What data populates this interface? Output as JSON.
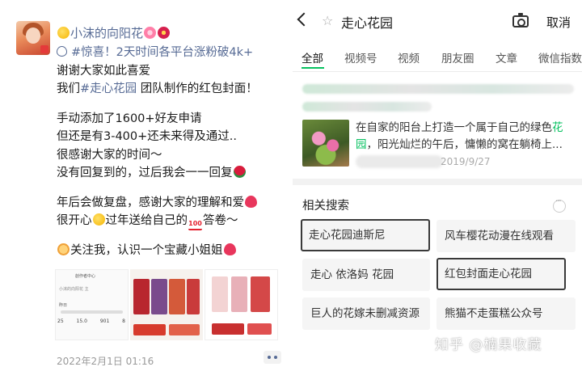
{
  "moment": {
    "username": "小沫的向阳花",
    "lines": [
      "#惊喜！2天时间各平台涨粉破4k+",
      "谢谢大家如此喜爱",
      "我们",
      "#走心花园",
      " 团队制作的红包封面！",
      "手动添加了1600+好友申请",
      "但还是有3-400+还未来得及通过..",
      "很感谢大家的时间～",
      "没有回复到的，过后我会一一回复",
      "年后会做复盘，感谢大家的理解和爱",
      "很开心",
      "过年送给自己的",
      "答卷～",
      "关注我，认识一个宝藏小姐姐"
    ],
    "thumb1": {
      "title": "創作者中心",
      "sub": "小沫的向阳花 主",
      "label": "昨日",
      "stats": [
        "25",
        "15.0",
        "901",
        "8"
      ]
    },
    "datetime": "2022年2月1日 01:16"
  },
  "search": {
    "query": "走心花园",
    "cancel_label": "取消",
    "tabs": [
      "全部",
      "视频号",
      "视频",
      "朋友圈",
      "文章",
      "微信指数"
    ],
    "active_tab": "全部",
    "article": {
      "text_before": "在自家的阳台上打造一个属于自己的绿色",
      "highlight_1": "花",
      "highlight_2": "园",
      "text_after": "，阳光灿烂的午后，慵懒的窝在躺椅上...",
      "date": "2019/9/27"
    },
    "related_title": "相关搜索",
    "related": [
      "走心花园迪斯尼",
      "风车樱花动漫在线观看",
      "走心 依洛妈 花园",
      "红包封面走心花园",
      "巨人的花嫁未删减资源",
      "熊猫不走蛋糕公众号"
    ]
  },
  "watermark": "知乎 @楠果收藏",
  "colors": {
    "link": "#576b95",
    "accent_green": "#07c160",
    "chip_bg": "#f5f5f5"
  }
}
